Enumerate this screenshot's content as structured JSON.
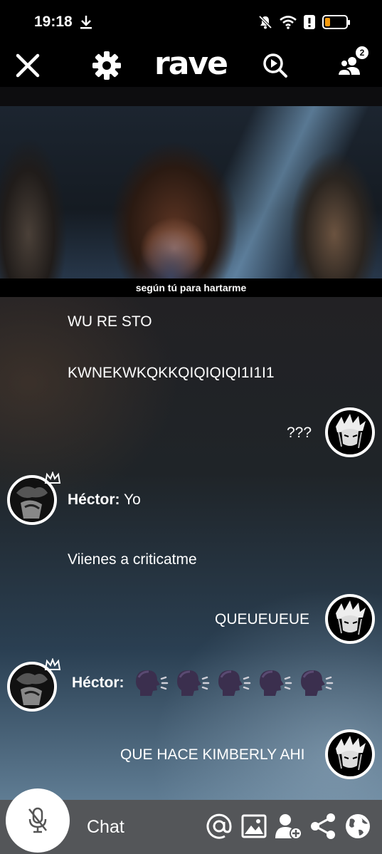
{
  "status_bar": {
    "time": "19:18",
    "icons": [
      "download-icon",
      "mute-bell-icon",
      "wifi-icon",
      "alert-icon",
      "battery-icon"
    ],
    "battery_level": 0.25,
    "battery_color": "#f59a0c"
  },
  "header": {
    "logo": "rave",
    "close_icon": "close-icon",
    "settings_icon": "gear-icon",
    "search_icon": "search-play-icon",
    "users_icon": "users-icon",
    "users_count": "2"
  },
  "video": {
    "subtitle": "según tú para hartarme"
  },
  "chat": {
    "messages": [
      {
        "sender": "",
        "text": "WU RE STO"
      },
      {
        "sender": "",
        "text": "KWNEKWKQKKQIQIQIQI1I1I1"
      },
      {
        "sender": "",
        "text": "???"
      },
      {
        "sender": "Héctor:",
        "text": "Yo"
      },
      {
        "sender": "",
        "text": "Viienes a criticatme"
      },
      {
        "sender": "",
        "text": "QUEUEUEUE"
      },
      {
        "sender": "Héctor:",
        "text": ""
      },
      {
        "sender": "",
        "text": "QUE HACE KIMBERLY AHI"
      }
    ]
  },
  "bottom_bar": {
    "chat_label": "Chat",
    "icons": [
      "mic-muted-icon",
      "mention-icon",
      "image-icon",
      "add-user-icon",
      "share-icon",
      "globe-icon"
    ]
  }
}
